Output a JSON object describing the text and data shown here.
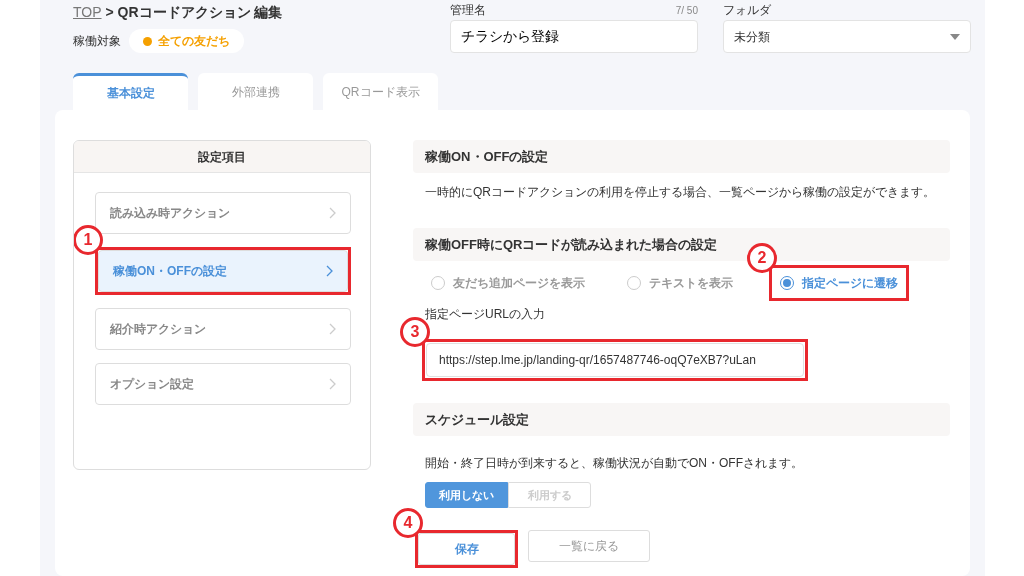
{
  "breadcrumb": {
    "link": "TOP",
    "separator": ">",
    "current": "QRコードアクション 編集"
  },
  "target": {
    "label": "稼働対象",
    "value": "全ての友だち"
  },
  "name_field": {
    "label": "管理名",
    "counter": "7/ 50",
    "value": "チラシから登録"
  },
  "folder_field": {
    "label": "フォルダ",
    "value": "未分類"
  },
  "tabs": [
    {
      "label": "基本設定",
      "selected": true
    },
    {
      "label": "外部連携",
      "selected": false
    },
    {
      "label": "QRコード表示",
      "selected": false
    }
  ],
  "settings_menu": {
    "title": "設定項目",
    "items": [
      {
        "label": "読み込み時アクション",
        "selected": false
      },
      {
        "label": "稼働ON・OFFの設定",
        "selected": true,
        "callout": "1"
      },
      {
        "label": "紹介時アクション",
        "selected": false
      },
      {
        "label": "オプション設定",
        "selected": false
      }
    ]
  },
  "operation_section": {
    "title": "稼働ON・OFFの設定",
    "description": "一時的にQRコードアクションの利用を停止する場合、一覧ページから稼働の設定ができます。"
  },
  "off_behavior_section": {
    "title": "稼働OFF時にQRコードが読み込まれた場合の設定",
    "options": [
      {
        "label": "友だち追加ページを表示",
        "selected": false
      },
      {
        "label": "テキストを表示",
        "selected": false
      },
      {
        "label": "指定ページに遷移",
        "selected": true,
        "callout": "2"
      }
    ],
    "url_field": {
      "label": "指定ページURLの入力",
      "value": "https://step.lme.jp/landing-qr/1657487746-oqQ7eXB7?uLan",
      "callout": "3"
    }
  },
  "schedule_section": {
    "title": "スケジュール設定",
    "description": "開始・終了日時が到来すると、稼働状況が自動でON・OFFされます。",
    "toggle": [
      {
        "label": "利用しない",
        "selected": true
      },
      {
        "label": "利用する",
        "selected": false
      }
    ]
  },
  "buttons": [
    {
      "label": "保存",
      "kind": "primary",
      "callout": "4"
    },
    {
      "label": "一覧に戻る",
      "kind": "secondary"
    }
  ]
}
